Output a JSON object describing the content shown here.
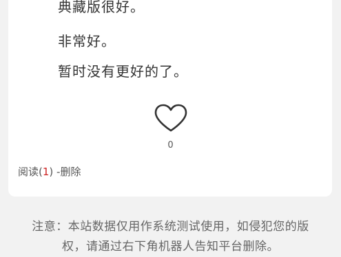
{
  "post": {
    "lines": [
      "典藏版很好。",
      "非常好。",
      "暂时没有更好的了。"
    ],
    "like_count": "0"
  },
  "meta": {
    "read_label": "阅读",
    "read_open": "(",
    "read_count": "1",
    "read_close": ")",
    "delete_label": " -删除"
  },
  "notice": {
    "line1": "注意：本站数据仅用作系统测试使用，如侵犯您的版",
    "line2": "权，请通过右下角机器人告知平台删除。"
  },
  "colors": {
    "background": "#f2f2f2",
    "card": "#ffffff",
    "count_red": "#cc2222"
  },
  "icons": {
    "like": "heart-outline-icon"
  }
}
